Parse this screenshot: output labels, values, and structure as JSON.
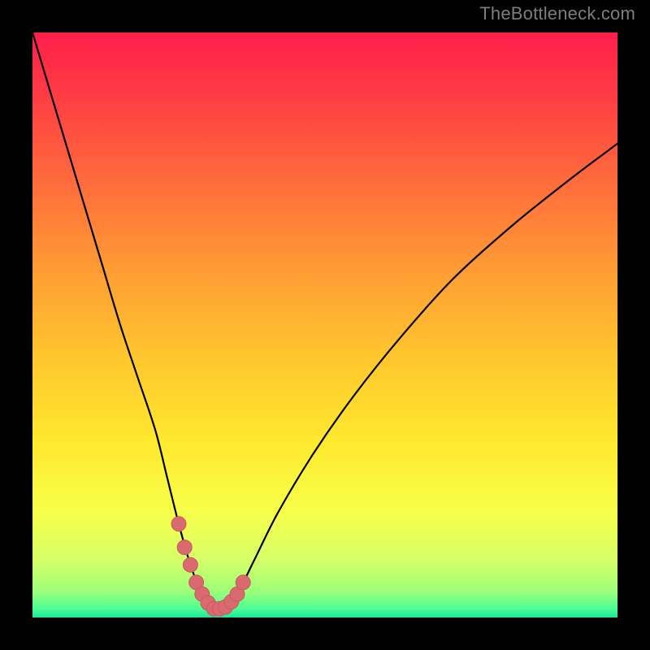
{
  "watermark": "TheBottleneck.com",
  "colors": {
    "frame": "#000000",
    "watermark_text": "#7d7d7d",
    "curve": "#000000",
    "marker_fill": "#d96a6f",
    "marker_stroke": "#c95a5f",
    "gradient_stops": [
      {
        "offset": 0.0,
        "color": "#ff1e4a"
      },
      {
        "offset": 0.1,
        "color": "#ff3a45"
      },
      {
        "offset": 0.25,
        "color": "#ff6a3c"
      },
      {
        "offset": 0.4,
        "color": "#ff9a34"
      },
      {
        "offset": 0.55,
        "color": "#ffc52e"
      },
      {
        "offset": 0.7,
        "color": "#ffe92e"
      },
      {
        "offset": 0.82,
        "color": "#f7ff4a"
      },
      {
        "offset": 0.9,
        "color": "#d6ff66"
      },
      {
        "offset": 0.955,
        "color": "#9dff7a"
      },
      {
        "offset": 0.985,
        "color": "#4dff93"
      },
      {
        "offset": 1.0,
        "color": "#18e89a"
      }
    ]
  },
  "chart_data": {
    "type": "line",
    "title": "",
    "xlabel": "",
    "ylabel": "",
    "xlim": [
      0,
      100
    ],
    "ylim": [
      0,
      100
    ],
    "grid": false,
    "legend": false,
    "series": [
      {
        "name": "bottleneck-curve",
        "x": [
          0,
          3,
          6,
          9,
          12,
          15,
          18,
          21,
          23,
          25,
          27,
          29,
          31,
          33,
          35,
          38,
          42,
          48,
          55,
          63,
          72,
          82,
          92,
          100
        ],
        "y": [
          100,
          90,
          80,
          70,
          60,
          50,
          41,
          32,
          24,
          16,
          9,
          4,
          1.5,
          1.5,
          4,
          10,
          18,
          28,
          38,
          48,
          58,
          67,
          75,
          81
        ]
      }
    ],
    "markers": {
      "name": "near-minimum-markers",
      "x": [
        25.0,
        26.0,
        27.0,
        28.0,
        29.0,
        30.0,
        31.0,
        32.0,
        33.0,
        34.0,
        35.0,
        36.0
      ],
      "y": [
        16,
        12,
        9,
        6,
        4,
        2.5,
        1.5,
        1.5,
        1.8,
        2.7,
        4,
        6
      ]
    },
    "minimum_x": 31.5
  }
}
